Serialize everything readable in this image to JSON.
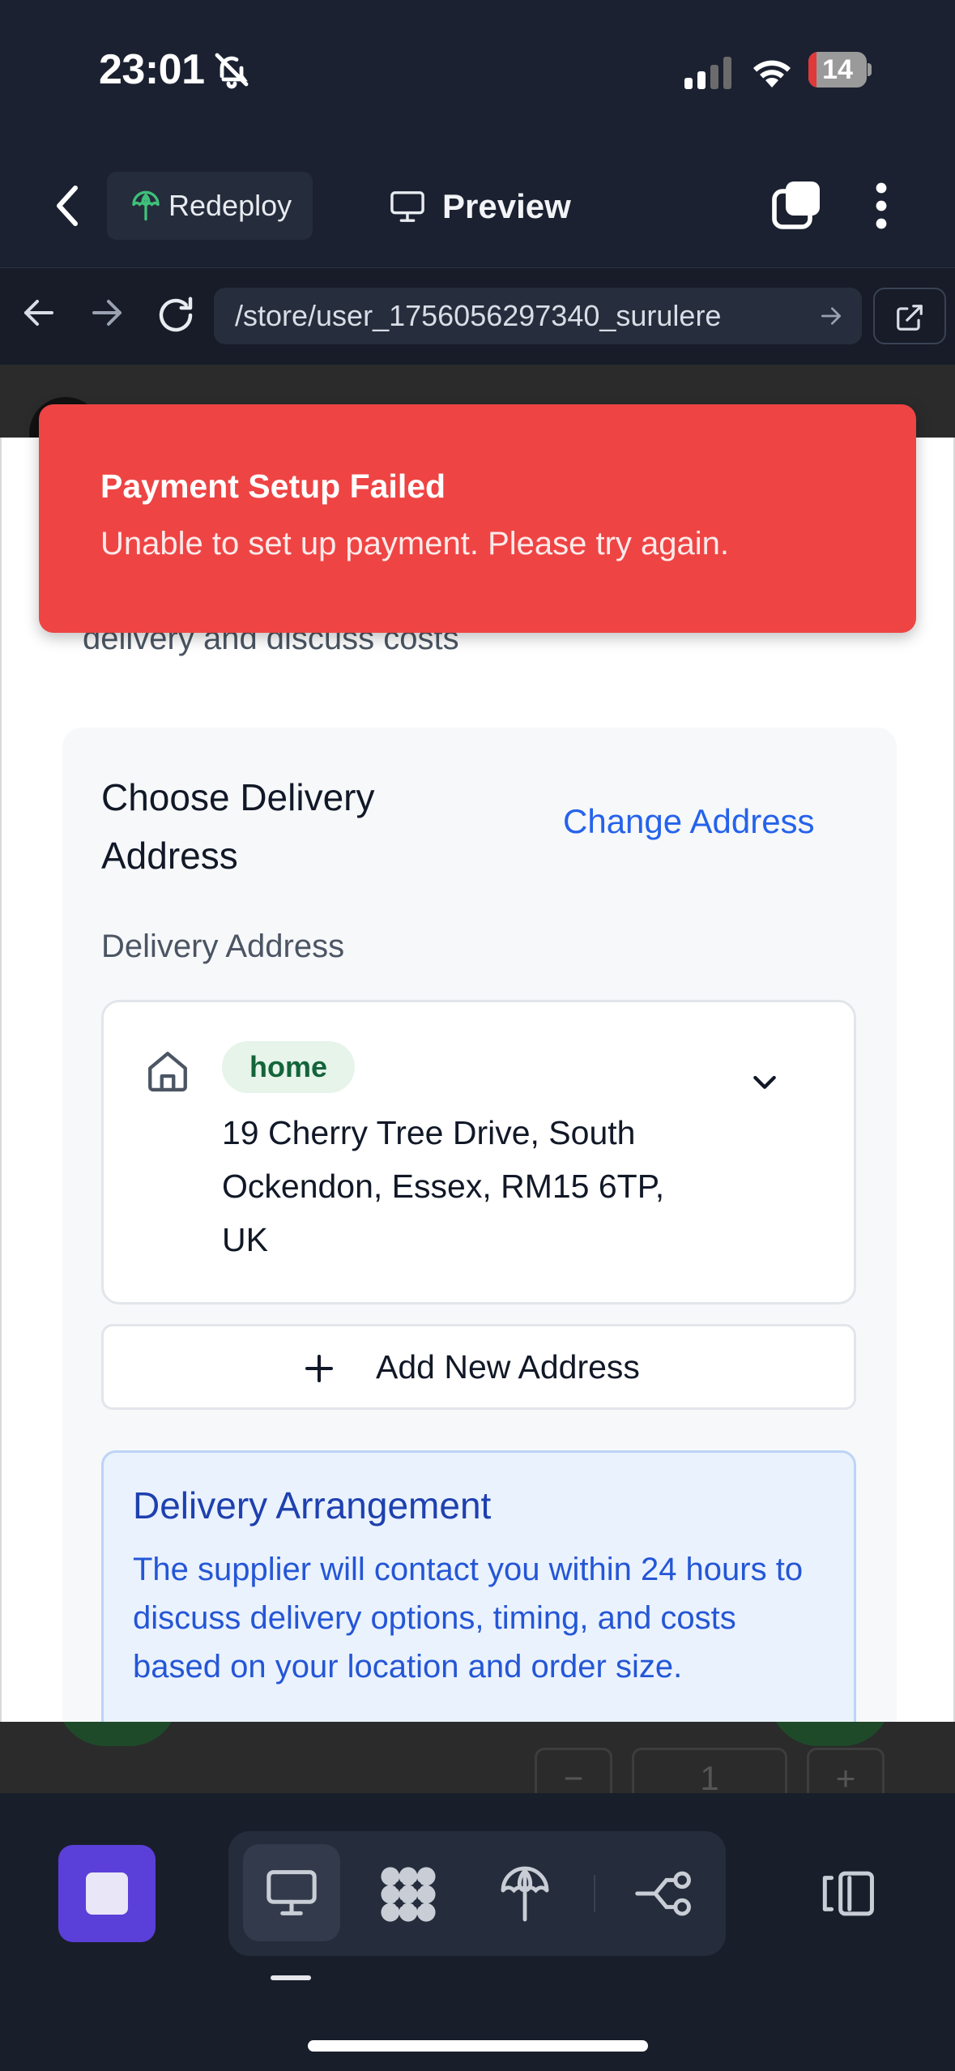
{
  "status_bar": {
    "time": "23:01",
    "battery_level": "14",
    "battery_fraction": 0.14,
    "battery_color": "#e0393a"
  },
  "toolbar": {
    "redeploy_label": "Redeploy",
    "preview_label": "Preview",
    "icons": [
      "chevron-left-icon",
      "redeploy-icon",
      "monitor-icon",
      "tabs-icon",
      "kebab-icon"
    ]
  },
  "browser": {
    "url": "/store/user_1756056297340_surulere",
    "icons": [
      "arrow-left-icon",
      "arrow-right-icon",
      "reload-icon",
      "url-go-icon",
      "open-external-icon"
    ]
  },
  "page": {
    "previous_option_text": "delivery and discuss costs",
    "section_title": "Choose Delivery Address",
    "change_address_label": "Change Address",
    "delivery_address_label": "Delivery Address",
    "address": {
      "badge": "home",
      "text": "19 Cherry Tree Drive, South Ockendon, Essex, RM15 6TP, UK"
    },
    "add_address_label": "Add New Address",
    "arrangement": {
      "title": "Delivery Arrangement",
      "text": "The supplier will contact you within 24 hours to discuss delivery options, timing, and costs based on your location and order size."
    },
    "quantity": {
      "minus": "−",
      "value": "1",
      "plus": "+"
    }
  },
  "toast": {
    "title": "Payment Setup Failed",
    "message": "Unable to set up payment. Please try again.",
    "color": "#ef4444"
  },
  "dock": {
    "icons": [
      "stop-icon",
      "desktop-icon",
      "apps-icon",
      "deploy-icon",
      "flow-icon",
      "panel-toggle-icon"
    ],
    "accent": "#5b3fd9"
  }
}
